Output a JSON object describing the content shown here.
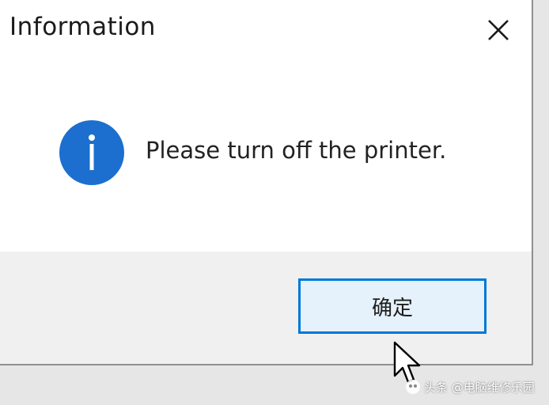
{
  "dialog": {
    "title": "Information",
    "message": "Please turn off the printer.",
    "ok_label": "确定",
    "close_icon": "close-icon",
    "message_icon": "info-icon"
  },
  "watermark": {
    "text": "头条 @电脑维修乐园"
  },
  "colors": {
    "accent": "#0078d7",
    "icon_blue": "#1c6fce",
    "button_fill": "#e5f1fb",
    "footer": "#f0f0f0"
  }
}
